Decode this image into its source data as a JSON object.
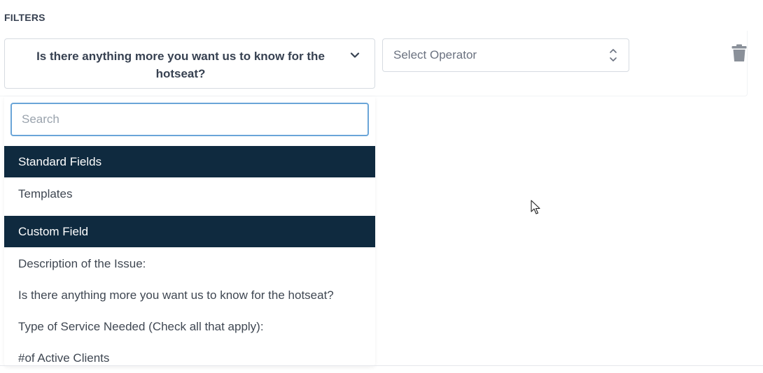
{
  "section": {
    "label": "FILTERS"
  },
  "filter": {
    "field_value": "Is there anything more you want us to know for the hotseat?",
    "operator_placeholder": "Select Operator"
  },
  "dropdown": {
    "search_placeholder": "Search",
    "groups": [
      {
        "label": "Standard Fields",
        "options": [
          "Templates"
        ]
      },
      {
        "label": "Custom Field",
        "options": [
          "Description of the Issue:",
          "Is there anything more you want us to know for the hotseat?",
          "Type of Service Needed (Check all that apply):",
          "#of Active Clients"
        ]
      }
    ]
  },
  "icons": {
    "field_dropdown": "chevron-down-icon",
    "operator_dropdown": "updown-icon",
    "delete": "trash-icon",
    "pointer": "cursor-icon"
  },
  "colors": {
    "group_header_bg": "#0f2a3f",
    "search_focus_border": "#6aa5d8",
    "trash_icon": "#8a9099"
  }
}
